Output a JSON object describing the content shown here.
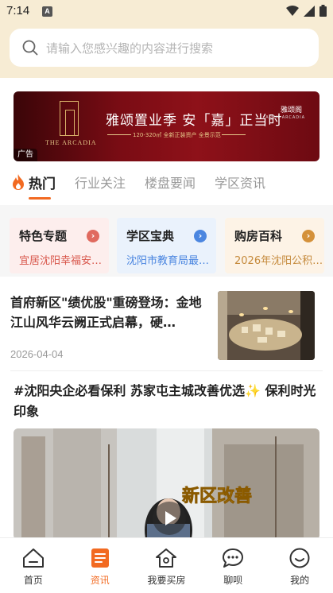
{
  "status_bar": {
    "time": "7:14",
    "notif_icon": "A"
  },
  "search": {
    "placeholder": "请输入您感兴趣的内容进行搜索"
  },
  "banner": {
    "title": "雅颂置业季  安「嘉」正当时",
    "subtitle": "120-320㎡  全新正装资产  全景示范",
    "brand": "雅颂阁",
    "brand_sub": "ARCH ARCADIA",
    "en": "THE ARCADIA",
    "ad_label": "广告"
  },
  "tabs": [
    "热门",
    "行业关注",
    "楼盘要闻",
    "学区资讯"
  ],
  "categories": [
    {
      "title": "特色专题",
      "desc": "宜居沈阳幸福安…",
      "bg": "#fdeeed",
      "accent": "#e06a5f",
      "desc_color": "#d8564b"
    },
    {
      "title": "学区宝典",
      "desc": "沈阳市教育局最…",
      "bg": "#eaf2fc",
      "accent": "#4b86e0",
      "desc_color": "#4b86e0"
    },
    {
      "title": "购房百科",
      "desc": "2026年沈阳公积…",
      "bg": "#fdf3e6",
      "accent": "#d4913a",
      "desc_color": "#c58a3c"
    }
  ],
  "news": [
    {
      "title": "首府新区\"绩优股\"重磅登场：金地江山风华云阙正式启幕，硬…",
      "date": "2026-04-04"
    },
    {
      "title": "#沈阳央企必看保利 苏家屯主城改善优选✨ 保利时光印象",
      "video_caption": "新区改善"
    }
  ],
  "bottom_nav": [
    {
      "label": "首页",
      "icon": "home-icon"
    },
    {
      "label": "资讯",
      "icon": "news-icon"
    },
    {
      "label": "我要买房",
      "icon": "buy-house-icon"
    },
    {
      "label": "聊呗",
      "icon": "chat-icon"
    },
    {
      "label": "我的",
      "icon": "smile-icon"
    }
  ],
  "colors": {
    "accent": "#f26a21",
    "header_bg": "#f7ecd4"
  }
}
